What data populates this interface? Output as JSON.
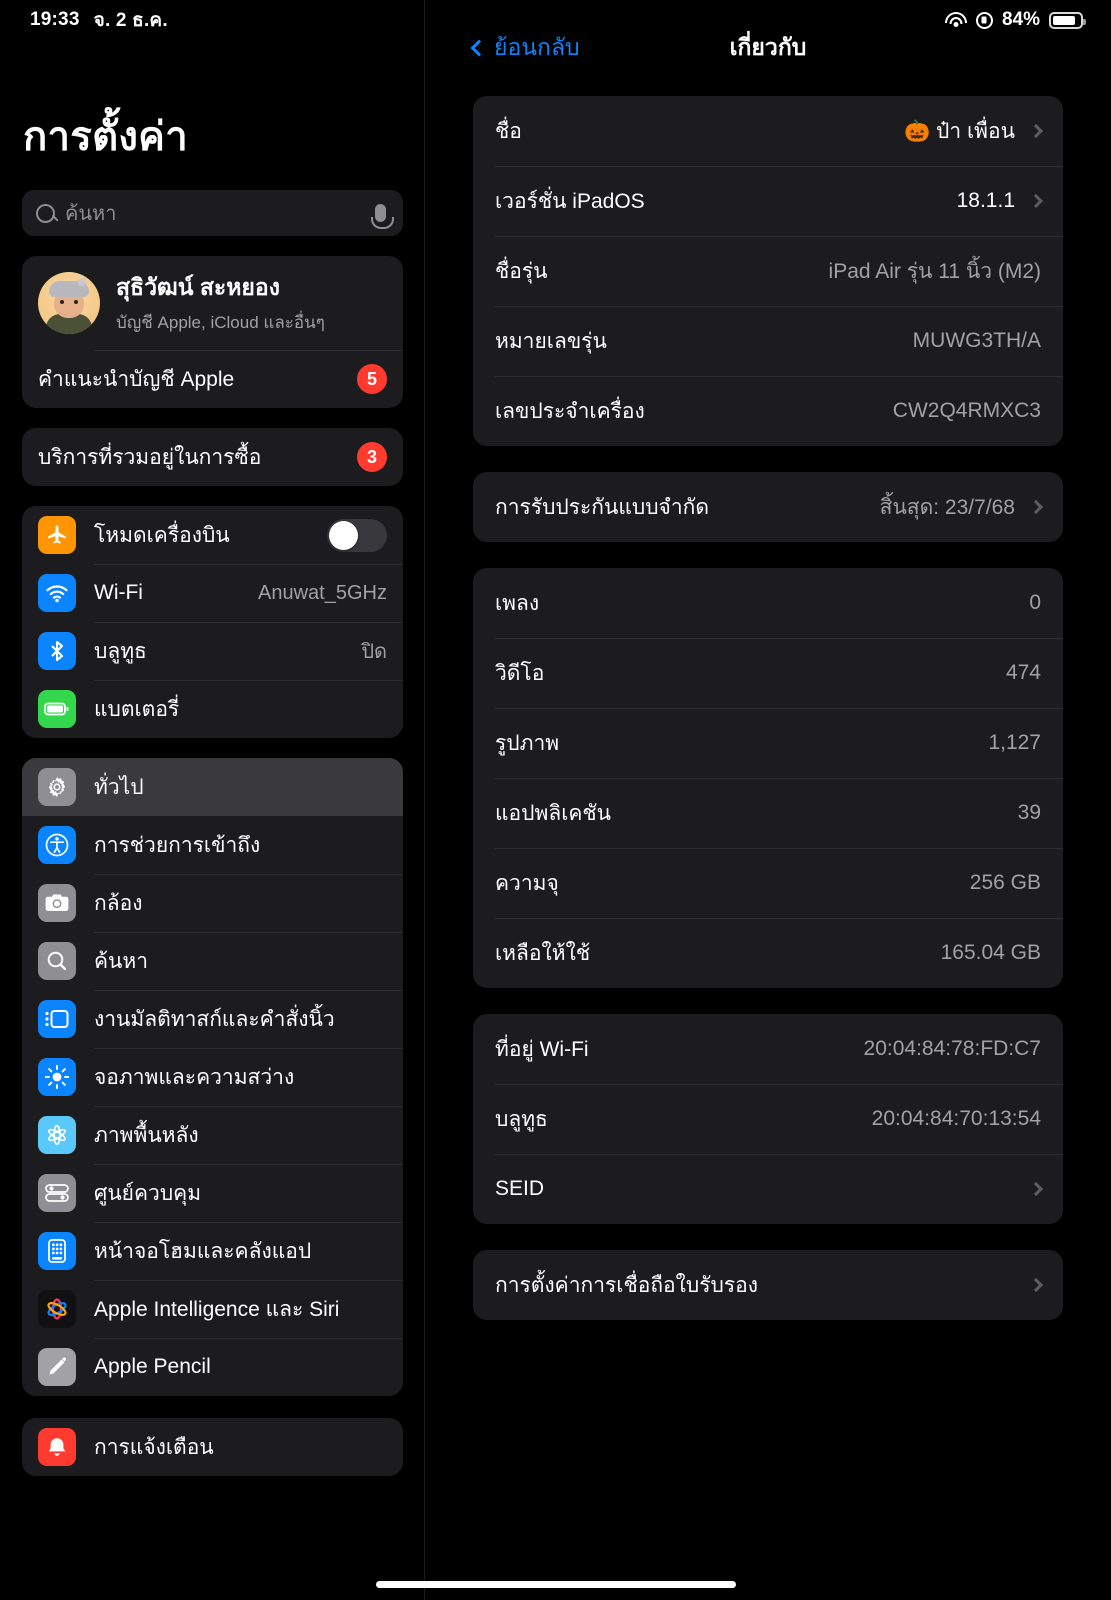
{
  "status_bar": {
    "time": "19:33",
    "date": "จ. 2 ธ.ค.",
    "wifi_icon": "wifi-icon",
    "rotation_lock_icon": "rotation-lock-icon",
    "battery_percent": "84%",
    "battery_icon": "battery-icon"
  },
  "sidebar": {
    "title": "การตั้งค่า",
    "search": {
      "placeholder": "ค้นหา",
      "value": "",
      "search_icon": "search-icon",
      "mic_icon": "microphone-icon"
    },
    "account": {
      "name": "สุธิวัฒน์ สะหยอง",
      "subtitle": "บัญชี Apple, iCloud และอื่นๆ",
      "avatar_icon": "memoji-avatar"
    },
    "suggestion_row": {
      "label": "คำแนะนำบัญชี Apple",
      "badge": "5"
    },
    "services_row": {
      "label": "บริการที่รวมอยู่ในการซื้อ",
      "badge": "3"
    },
    "connectivity": [
      {
        "label": "โหมดเครื่องบิน",
        "icon": "airplane-icon",
        "control": "toggle",
        "toggle_on": false,
        "value": ""
      },
      {
        "label": "Wi-Fi",
        "icon": "wifi-icon",
        "value": "Anuwat_5GHz"
      },
      {
        "label": "บลูทูธ",
        "icon": "bluetooth-icon",
        "value": "ปิด"
      },
      {
        "label": "แบตเตอรี่",
        "icon": "battery-icon",
        "value": ""
      }
    ],
    "general_items": [
      {
        "label": "ทั่วไป",
        "icon": "gear-icon",
        "selected": true
      },
      {
        "label": "การช่วยการเข้าถึง",
        "icon": "accessibility-icon",
        "selected": false
      },
      {
        "label": "กล้อง",
        "icon": "camera-icon",
        "selected": false
      },
      {
        "label": "ค้นหา",
        "icon": "search-icon",
        "selected": false
      },
      {
        "label": "งานมัลติทาสก์และคำสั่งนิ้ว",
        "icon": "multitasking-icon",
        "selected": false
      },
      {
        "label": "จอภาพและความสว่าง",
        "icon": "brightness-icon",
        "selected": false
      },
      {
        "label": "ภาพพื้นหลัง",
        "icon": "wallpaper-icon",
        "selected": false
      },
      {
        "label": "ศูนย์ควบคุม",
        "icon": "control-center-icon",
        "selected": false
      },
      {
        "label": "หน้าจอโฮมและคลังแอป",
        "icon": "home-screen-icon",
        "selected": false
      },
      {
        "label": "Apple Intelligence และ Siri",
        "icon": "apple-intelligence-icon",
        "selected": false
      },
      {
        "label": "Apple Pencil",
        "icon": "pencil-icon",
        "selected": false
      }
    ],
    "partial_item": {
      "label": "การแจ้งเตือน",
      "icon": "notifications-icon"
    }
  },
  "detail": {
    "back_label": "ย้อนกลับ",
    "back_icon": "chevron-left-icon",
    "title": "เกี่ยวกับ",
    "groups": [
      {
        "rows": [
          {
            "label": "ชื่อ",
            "value": "🎃 ป๋า เพื่อน",
            "chevron": true,
            "value_white": true
          },
          {
            "label": "เวอร์ชั่น iPadOS",
            "value": "18.1.1",
            "chevron": true,
            "value_white": true
          },
          {
            "label": "ชื่อรุ่น",
            "value": "iPad Air รุ่น 11 นิ้ว (M2)",
            "chevron": false
          },
          {
            "label": "หมายเลขรุ่น",
            "value": "MUWG3TH/A",
            "chevron": false
          },
          {
            "label": "เลขประจำเครื่อง",
            "value": "CW2Q4RMXC3",
            "chevron": false
          }
        ]
      },
      {
        "rows": [
          {
            "label": "การรับประกันแบบจำกัด",
            "value": "สิ้นสุด: 23/7/68",
            "chevron": true
          }
        ]
      },
      {
        "rows": [
          {
            "label": "เพลง",
            "value": "0",
            "chevron": false
          },
          {
            "label": "วิดีโอ",
            "value": "474",
            "chevron": false
          },
          {
            "label": "รูปภาพ",
            "value": "1,127",
            "chevron": false
          },
          {
            "label": "แอปพลิเคชัน",
            "value": "39",
            "chevron": false
          },
          {
            "label": "ความจุ",
            "value": "256 GB",
            "chevron": false
          },
          {
            "label": "เหลือให้ใช้",
            "value": "165.04 GB",
            "chevron": false
          }
        ]
      },
      {
        "rows": [
          {
            "label": "ที่อยู่ Wi-Fi",
            "value": "20:04:84:78:FD:C7",
            "chevron": false
          },
          {
            "label": "บลูทูธ",
            "value": "20:04:84:70:13:54",
            "chevron": false
          },
          {
            "label": "SEID",
            "value": "",
            "chevron": true
          }
        ]
      },
      {
        "rows": [
          {
            "label": "การตั้งค่าการเชื่อถือใบรับรอง",
            "value": "",
            "chevron": true
          }
        ]
      }
    ]
  }
}
